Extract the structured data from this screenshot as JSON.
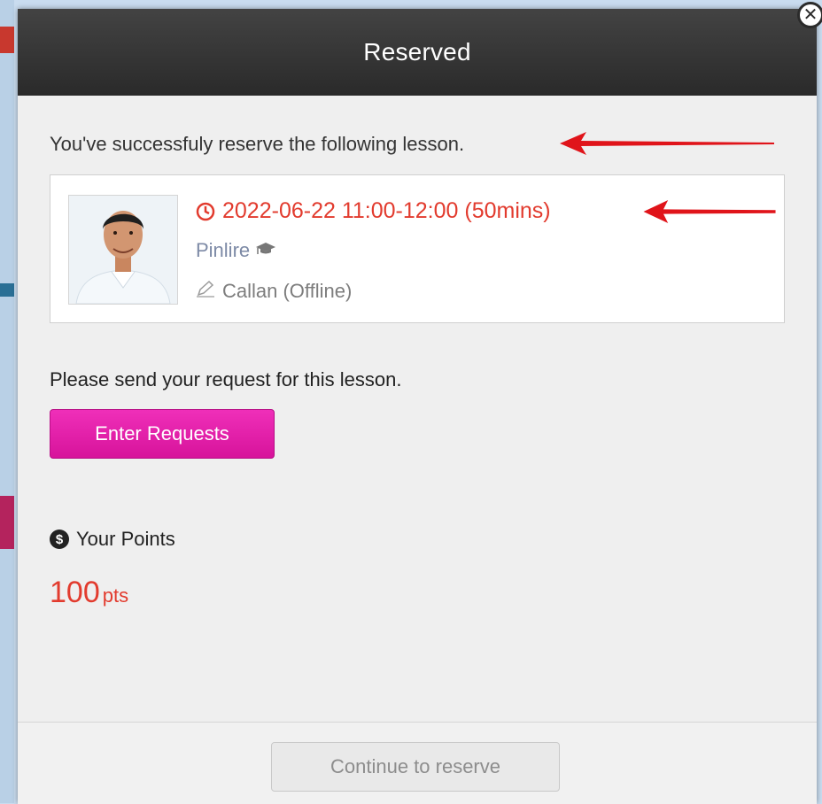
{
  "modal": {
    "title": "Reserved",
    "close_glyph": "✕"
  },
  "intro_text": "You've successfuly reserve the following lesson.",
  "lesson": {
    "time": "2022-06-22 11:00-12:00 (50mins)",
    "teacher": "Pinlire",
    "course": "Callan (Offline)",
    "icons": [
      "clock-icon",
      "graduation-cap-icon",
      "pencil-icon"
    ]
  },
  "request": {
    "prompt": "Please send your request for this lesson.",
    "button_label": "Enter Requests"
  },
  "points": {
    "label": "Your Points",
    "value": "100",
    "unit": "pts"
  },
  "footer": {
    "continue_label": "Continue to reserve"
  },
  "colors": {
    "accent_red": "#e23b2e",
    "request_button": "#e51ea9",
    "header_bg": "#343434",
    "annotation_arrow": "#e0141a"
  }
}
